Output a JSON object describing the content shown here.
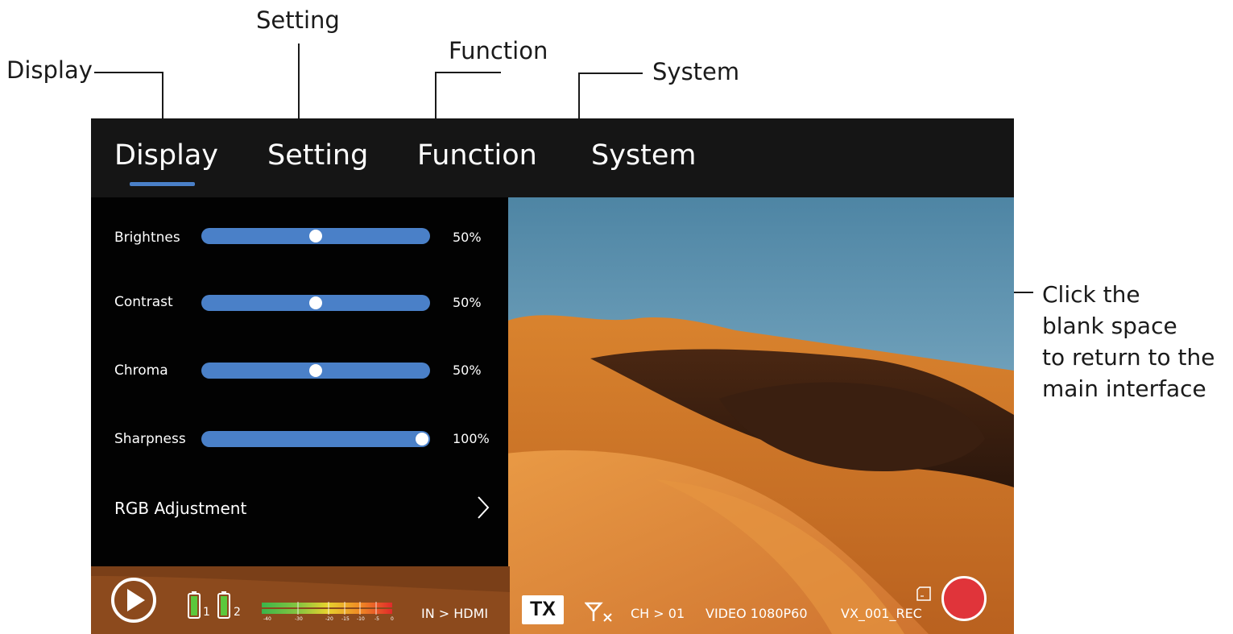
{
  "callouts": {
    "display": "Display",
    "setting": "Setting",
    "function": "Function",
    "system": "System",
    "blank_line1": "Click the",
    "blank_line2": "blank space",
    "blank_line3": "to return to the",
    "blank_line4": "main interface"
  },
  "tabs": [
    {
      "label": "Display",
      "active": true
    },
    {
      "label": "Setting"
    },
    {
      "label": "Function"
    },
    {
      "label": "System"
    }
  ],
  "settings": [
    {
      "label": "Brightnes",
      "value": "50%",
      "level": 0.5
    },
    {
      "label": "Contrast",
      "value": "50%",
      "level": 0.5
    },
    {
      "label": "Chroma",
      "value": "50%",
      "level": 0.5
    },
    {
      "label": "Sharpness",
      "value": "100%",
      "level": 1.0
    }
  ],
  "rgb_adjustment": {
    "label": "RGB Adjustment"
  },
  "status": {
    "battery1": "1",
    "battery2": "2",
    "meter_ticks": [
      "-40",
      "-30",
      "-20",
      "-15",
      "-10",
      "-5",
      "0"
    ],
    "input": "IN > HDMI",
    "tx": "TX",
    "channel": "CH > 01",
    "video": "VIDEO 1080P60",
    "filename": "VX_001_REC"
  },
  "colors": {
    "accent": "#4a80c8",
    "record": "#e0343a"
  }
}
